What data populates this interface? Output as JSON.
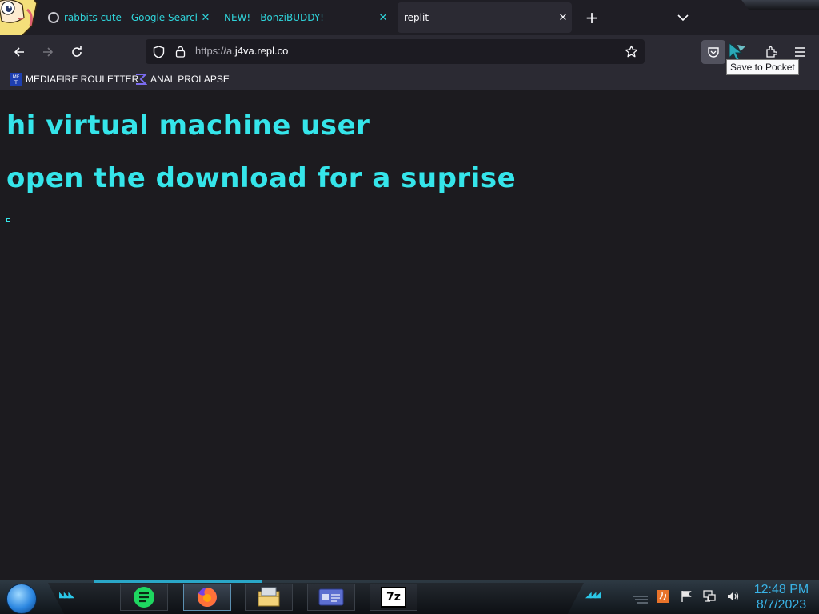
{
  "tabs": [
    {
      "title": "rabbits cute - Google Search",
      "close": "✕"
    },
    {
      "title": "NEW! - BonziBUDDY!",
      "close": "✕"
    },
    {
      "title": "replit",
      "close": "✕",
      "active": true
    }
  ],
  "new_tab_symbol": "+",
  "url": {
    "scheme": "https://",
    "subdomain": "a.",
    "host": "j4va.repl.co"
  },
  "bookmarks": [
    {
      "label": "MEDIAFIRE ROULETTER",
      "icon": "mediafire-icon"
    },
    {
      "label": "ANAL PROLAPSE",
      "icon": "sigma-icon"
    }
  ],
  "tooltip": "Save to Pocket",
  "page": {
    "line1": "hi virtual machine user",
    "line2": "open the download for a suprise"
  },
  "taskbar": {
    "apps": [
      "notes-icon",
      "firefox-icon",
      "file-explorer-icon",
      "id-card-icon",
      "7zip-icon"
    ],
    "sevenzip_label": "7z",
    "clock_time": "12:48 PM",
    "clock_date": "8/7/2023"
  },
  "colors": {
    "accent": "#35e5ea",
    "tab_text": "#2fd3d9",
    "chrome": "#2b2a33",
    "clock": "#39b3e6"
  }
}
